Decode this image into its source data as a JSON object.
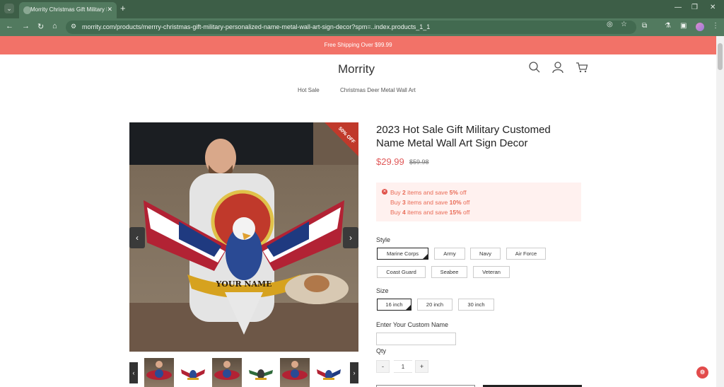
{
  "browser": {
    "tab_title": "Morrity Christmas Gift Military P",
    "tab_close": "✕",
    "new_tab": "+",
    "url": "morrity.com/products/merrry-christmas-gift-military-personalized-name-metal-wall-art-sign-decor?spm=..index.products_1_1",
    "icons": [
      "tab-menu",
      "back",
      "forward",
      "reload",
      "home",
      "site-info",
      "eye-off",
      "bookmark-star",
      "extensions",
      "lab",
      "sidebar",
      "profile",
      "menu",
      "minimize",
      "restore",
      "close"
    ]
  },
  "promo": {
    "text": "Free Shipping Over $99.99"
  },
  "header": {
    "logo": "Morrity",
    "nav": [
      "Hot Sale",
      "Christmas Deer Metal Wall Art"
    ],
    "icons": [
      "search-icon",
      "account-icon",
      "cart-icon"
    ]
  },
  "gallery": {
    "badge": "50% OFF",
    "banner_text": "YOUR NAME",
    "prev": "‹",
    "next": "›",
    "thumb_count": 6
  },
  "product": {
    "title": "2023 Hot Sale Gift Military Customed Name Metal Wall Art Sign Decor",
    "price": "$29.99",
    "compare_price": "$59.98",
    "discounts": [
      {
        "prefix": "Buy ",
        "qty": "2",
        "mid": " items and save ",
        "pct": "5%",
        "suffix": " off"
      },
      {
        "prefix": "Buy ",
        "qty": "3",
        "mid": " items and save ",
        "pct": "10%",
        "suffix": " off"
      },
      {
        "prefix": "Buy ",
        "qty": "4",
        "mid": " items and save ",
        "pct": "15%",
        "suffix": " off"
      }
    ],
    "style_label": "Style",
    "styles": [
      "Marine Corps",
      "Army",
      "Navy",
      "Air Force",
      "Coast Guard",
      "Seabee",
      "Veteran"
    ],
    "style_selected": "Marine Corps",
    "size_label": "Size",
    "sizes": [
      "16 inch",
      "20 inch",
      "30 inch"
    ],
    "size_selected": "16 inch",
    "custom_name_label": "Enter Your Custom Name",
    "custom_name_value": "",
    "qty_label": "Qty",
    "qty_minus": "-",
    "qty_value": "1",
    "qty_plus": "+"
  },
  "colors": {
    "promo": "#f27268",
    "price": "#e05858",
    "chrome": "#527a5f"
  }
}
